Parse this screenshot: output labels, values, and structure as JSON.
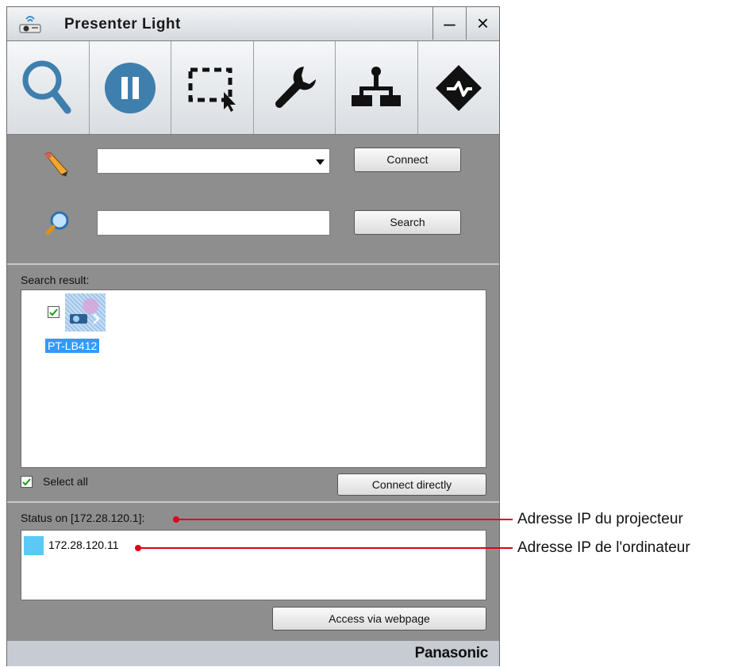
{
  "window": {
    "title": "Presenter Light"
  },
  "titlebar": {
    "minimize_label": "–",
    "close_label": "×"
  },
  "connect": {
    "dropdown_value": "",
    "button_label": "Connect"
  },
  "search": {
    "input_value": "",
    "button_label": "Search"
  },
  "results": {
    "heading": "Search result:",
    "items": [
      {
        "name": "PT-LB412",
        "checked": true
      }
    ],
    "select_all_label": "Select all",
    "connect_directly_label": "Connect directly"
  },
  "status": {
    "heading": "Status on [172.28.120.1]:",
    "entry_ip": "172.28.120.11",
    "entry_color": "#5bc8f5",
    "access_label": "Access via webpage"
  },
  "footer": {
    "brand": "Panasonic"
  },
  "annotations": {
    "projector_ip": "Adresse IP du projecteur",
    "computer_ip": "Adresse IP de l'ordinateur",
    "color": "#e0001a"
  },
  "colors": {
    "accent": "#3f7fae",
    "selection": "#3399ff"
  },
  "icons": [
    "projector-icon",
    "search-icon",
    "pause-icon",
    "select-area-icon",
    "wrench-icon",
    "network-icon",
    "diamond-check-icon",
    "pencil-icon",
    "magnifier-icon",
    "dropdown-arrow-icon",
    "checkbox-icon"
  ]
}
